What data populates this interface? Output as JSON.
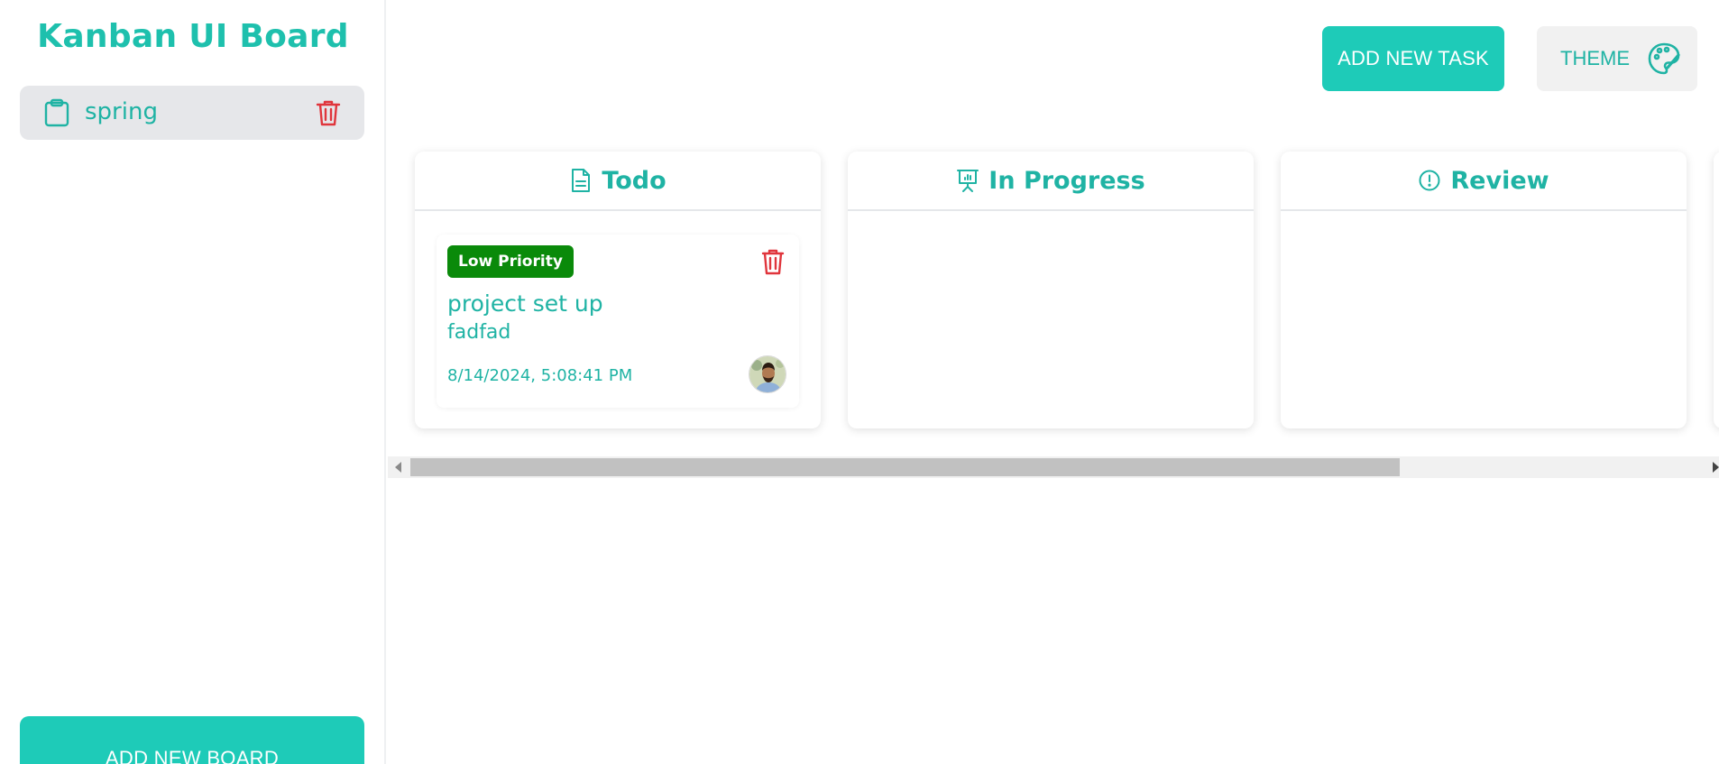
{
  "sidebar": {
    "title": "Kanban UI Board",
    "boards": [
      {
        "label": "spring",
        "icon": "clipboard-icon",
        "action_icon": "trash-icon"
      }
    ],
    "add_board_label": "ADD NEW BOARD"
  },
  "header": {
    "add_task_label": "ADD NEW TASK",
    "theme_label": "THEME",
    "theme_icon": "palette-icon"
  },
  "columns": [
    {
      "title": "Todo",
      "icon": "document-icon"
    },
    {
      "title": "In Progress",
      "icon": "presentation-chart-icon"
    },
    {
      "title": "Review",
      "icon": "alert-circle-icon"
    }
  ],
  "tasks": [
    {
      "column": "Todo",
      "priority": "Low Priority",
      "title": "project set up",
      "description": "fadfad",
      "timestamp": "8/14/2024, 5:08:41 PM",
      "avatar": "user-avatar"
    }
  ],
  "colors": {
    "accent": "#1ecbb8",
    "text_accent": "#1fb3a4",
    "danger": "#e0353c",
    "priority_low": "#0a8a0a",
    "board_item_bg": "#e6e7ea"
  }
}
